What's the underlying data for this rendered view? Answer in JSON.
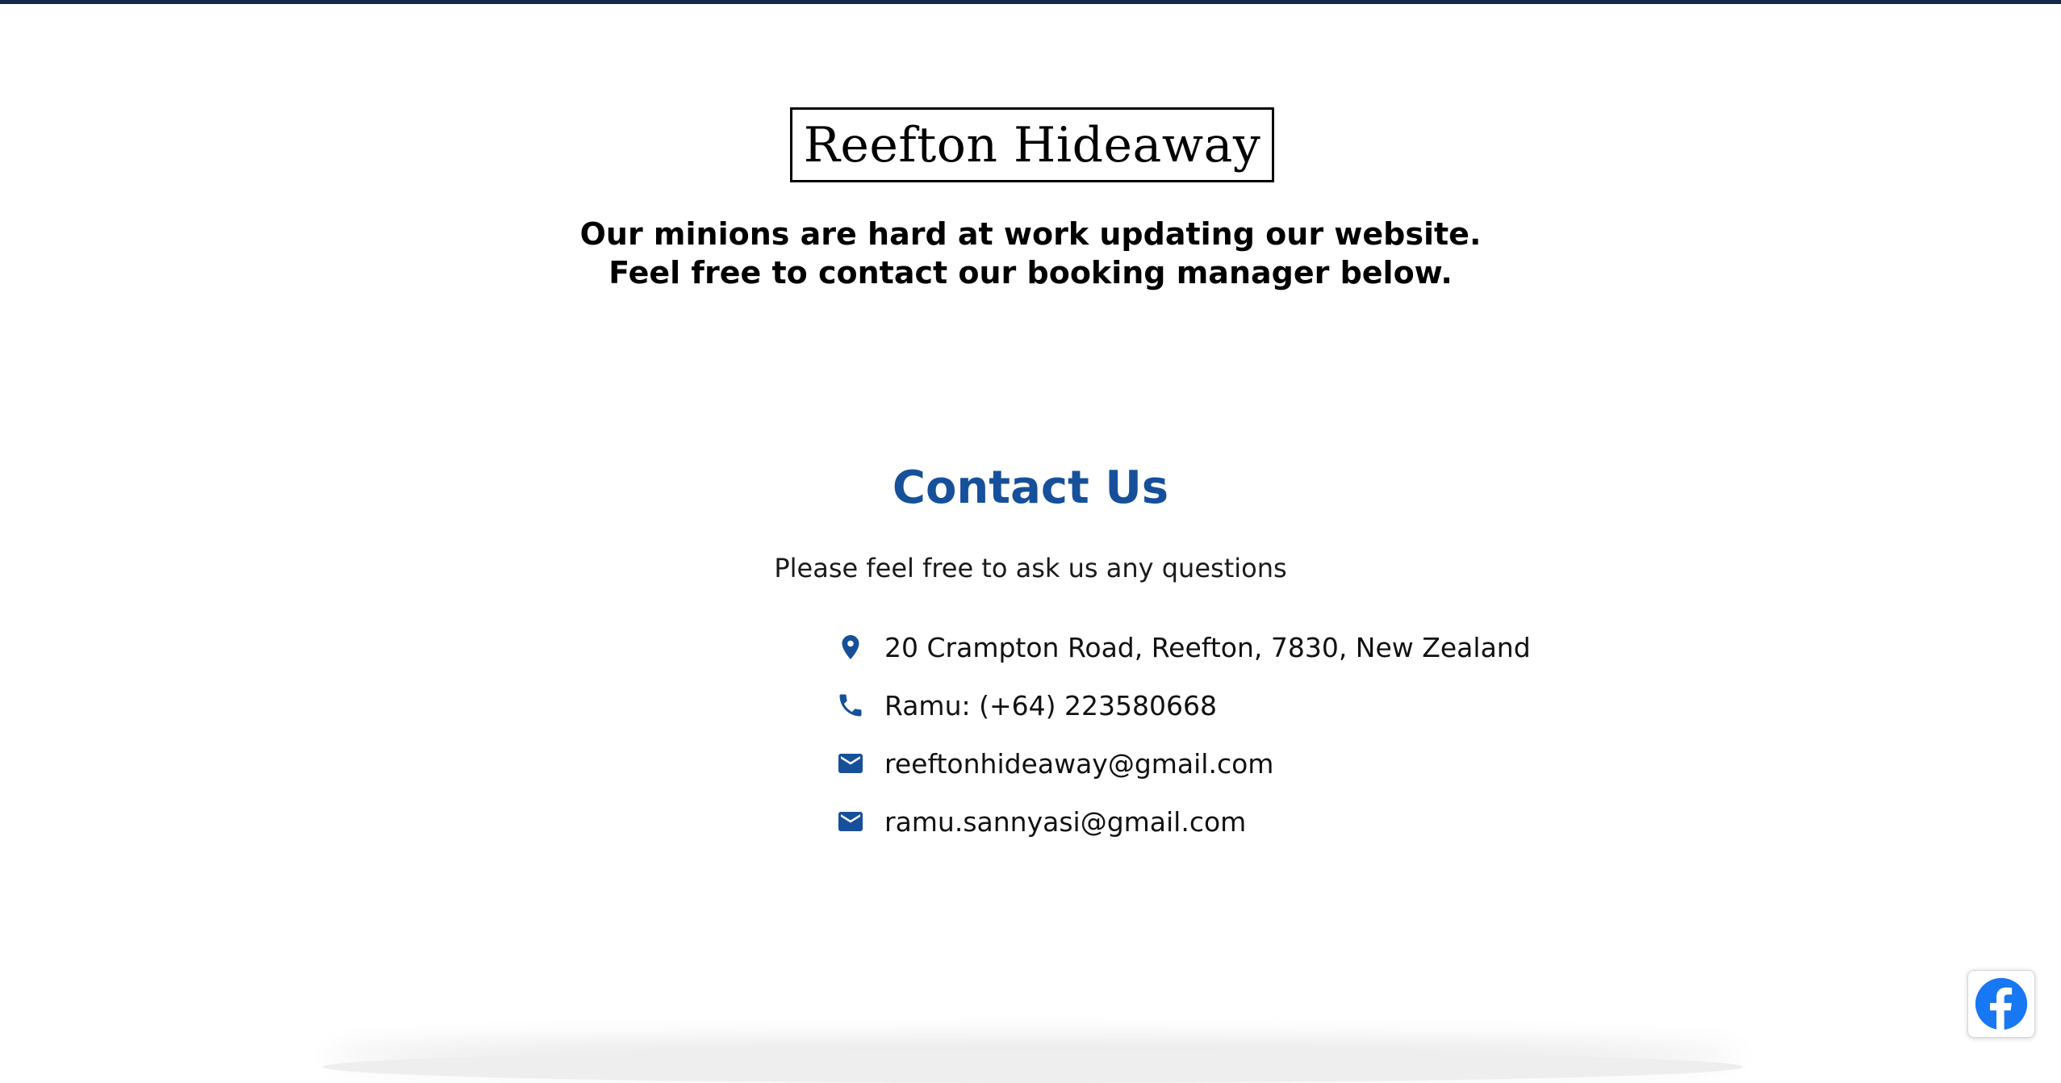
{
  "brand": {
    "name": "Reefton Hideaway"
  },
  "notice": {
    "line1": "Our minions are hard at work updating our website.",
    "line2": "Feel free to contact our booking manager below."
  },
  "contact": {
    "title": "Contact Us",
    "subtitle": "Please feel free to ask us any questions",
    "items": [
      {
        "icon": "location-pin-icon",
        "text": "20 Crampton Road, Reefton, 7830, New Zealand"
      },
      {
        "icon": "phone-icon",
        "text": "Ramu: (+64) 223580668"
      },
      {
        "icon": "mail-icon",
        "text": "reeftonhideaway@gmail.com"
      },
      {
        "icon": "mail-icon",
        "text": "ramu.sannyasi@gmail.com"
      }
    ]
  },
  "social": {
    "facebook_icon": "facebook-icon"
  },
  "colors": {
    "accent": "#16509a",
    "top_border": "#14294a",
    "facebook": "#1877f2"
  }
}
